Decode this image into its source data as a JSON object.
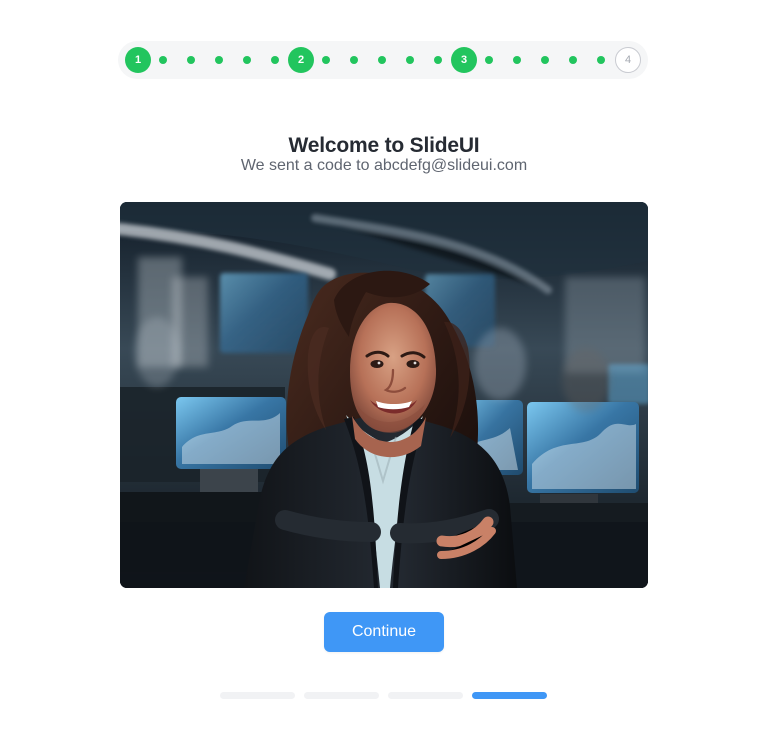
{
  "stepper": {
    "steps": [
      {
        "label": "1",
        "status": "completed"
      },
      {
        "label": "2",
        "status": "completed"
      },
      {
        "label": "3",
        "status": "completed"
      },
      {
        "label": "4",
        "status": "upcoming"
      }
    ],
    "accent_color": "#22c55e",
    "pending_color": "#c9cbd1"
  },
  "header": {
    "title": "Welcome to SlideUI",
    "subtitle": "We sent a code to abcdefg@slideui.com"
  },
  "hero_image": {
    "alt": "Smiling professional woman in an office"
  },
  "actions": {
    "continue_label": "Continue",
    "button_color": "#3f97f6"
  },
  "pagination": {
    "total_pages": 4,
    "active_page": 4,
    "active_color": "#3f97f6",
    "inactive_color": "#f1f2f4"
  }
}
